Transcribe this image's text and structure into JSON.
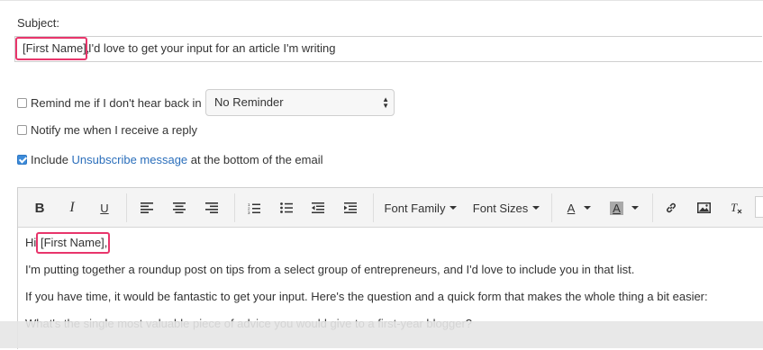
{
  "subject": {
    "label": "Subject:",
    "token": "[First Name],",
    "rest": "I'd love to get your input for an article I'm writing"
  },
  "options": {
    "remind_label": "Remind me if I don't hear back in",
    "remind_checked": false,
    "reminder_value": "No Reminder",
    "notify_label": "Notify me when I receive a reply",
    "notify_checked": false,
    "include_prefix": "Include",
    "include_link": "Unsubscribe message",
    "include_suffix": "at the bottom of the email",
    "include_checked": true
  },
  "toolbar": {
    "bold": "B",
    "italic": "I",
    "underline": "U",
    "font_family": "Font Family",
    "font_sizes": "Font Sizes",
    "text_color": "A",
    "bg_color": "A"
  },
  "body": {
    "greeting": "Hi",
    "token": "[First Name],",
    "p1": "I'm putting together a roundup post on tips from a select group of entrepreneurs, and I'd love to include you in that list.",
    "p2": "If you have time, it would be fantastic to get your input. Here's the question and a quick form that makes the whole thing a bit easier:",
    "p3": "What's the single most valuable piece of advice you would give to a first-year blogger?"
  },
  "colors": {
    "highlight": "#e8356b",
    "link": "#2a6ebb",
    "checkbox_checked": "#3d8bd9"
  }
}
